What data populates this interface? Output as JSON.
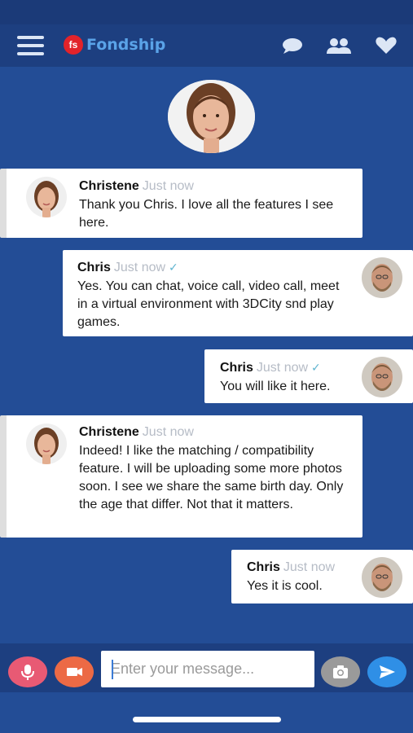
{
  "app": {
    "logo_badge": "fs",
    "logo_text": "Fondship"
  },
  "header": {
    "icons": [
      "menu-icon",
      "chat-bubble-icon",
      "people-icon",
      "heart-icon"
    ]
  },
  "messages": [
    {
      "sender": "Christene",
      "time": "Just now",
      "side": "left",
      "check": "",
      "text": "Thank you Chris. I love all the features I see here."
    },
    {
      "sender": "Chris",
      "time": "Just now",
      "side": "right",
      "check": "✓",
      "text": "Yes. You can chat, voice call, video call, meet in a virtual environment with 3DCity snd play games."
    },
    {
      "sender": "Chris",
      "time": "Just now",
      "side": "right",
      "check": "✓",
      "text": "You will like it here."
    },
    {
      "sender": "Christene",
      "time": "Just now",
      "side": "left",
      "check": "",
      "text": "Indeed! I like the matching / compatibility feature. I will be uploading some more photos soon. I see we share the same birth day. Only the age that differ. Not that it matters."
    },
    {
      "sender": "Chris",
      "time": "Just now",
      "side": "right",
      "check": "",
      "text": "Yes it is cool."
    }
  ],
  "composer": {
    "placeholder": "Enter your message...",
    "value": ""
  },
  "colors": {
    "background": "#234d96",
    "header": "#1d3f80",
    "mic_button": "#e85a74",
    "video_button": "#ec6a45",
    "camera_button": "#9a9a9a",
    "send_button": "#2f8fe6",
    "logo_badge": "#e2232a",
    "logo_text": "#5aa3e8"
  }
}
